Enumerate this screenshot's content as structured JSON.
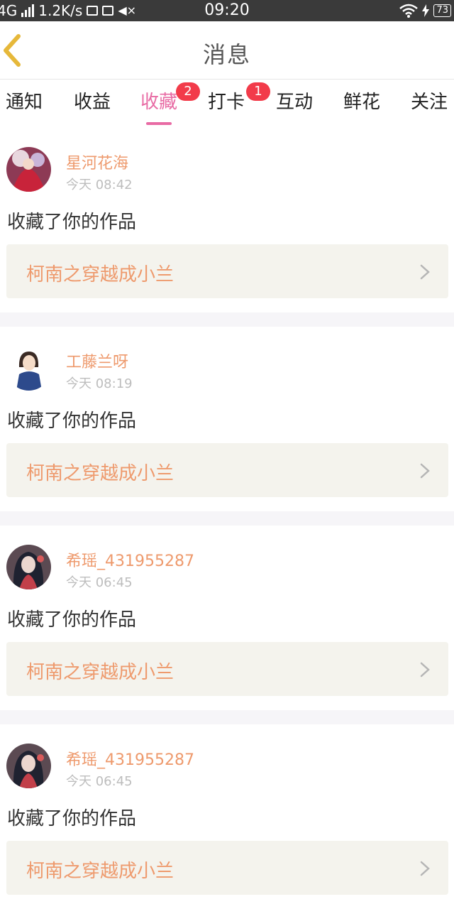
{
  "status_bar": {
    "network": "4G",
    "speed": "1.2K/s",
    "time": "09:20",
    "battery": "73"
  },
  "header": {
    "title": "消息",
    "back_icon": "chevron-left-icon"
  },
  "tabs": [
    {
      "label": "通知",
      "badge": ""
    },
    {
      "label": "收益",
      "badge": ""
    },
    {
      "label": "收藏",
      "badge": "2",
      "active": true
    },
    {
      "label": "打卡",
      "badge": "1"
    },
    {
      "label": "互动",
      "badge": ""
    },
    {
      "label": "鲜花",
      "badge": ""
    },
    {
      "label": "关注",
      "badge": ""
    }
  ],
  "messages": [
    {
      "user": "星河花海",
      "time": "今天 08:42",
      "action": "收藏了你的作品",
      "work": "柯南之穿越成小兰"
    },
    {
      "user": "工藤兰呀",
      "time": "今天 08:19",
      "action": "收藏了你的作品",
      "work": "柯南之穿越成小兰"
    },
    {
      "user": "希瑶_431955287",
      "time": "今天 06:45",
      "action": "收藏了你的作品",
      "work": "柯南之穿越成小兰"
    },
    {
      "user": "希瑶_431955287",
      "time": "今天 06:45",
      "action": "收藏了你的作品",
      "work": "柯南之穿越成小兰"
    }
  ],
  "colors": {
    "accent_pink": "#e86ba4",
    "username_orange": "#ee9a6d",
    "badge_red": "#f23b4a",
    "link_bg": "#f4f3ed"
  }
}
